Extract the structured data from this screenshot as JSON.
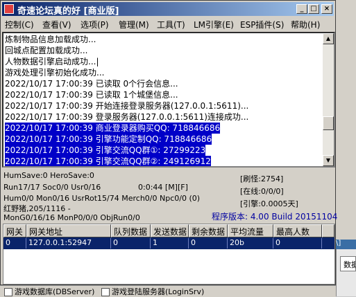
{
  "window": {
    "title": "奇速论坛真的好 [商业版]",
    "min": "_",
    "max": "□",
    "close": "×"
  },
  "menu": [
    "控制(C)",
    "查看(V)",
    "选项(P)",
    "管理(M)",
    "工具(T)",
    "LM引擎(E)",
    "ESP插件(S)",
    "帮助(H)"
  ],
  "log": [
    {
      "text": "炼制物品信息加载成功...",
      "selected": false
    },
    {
      "text": "回城点配置加载成功...",
      "selected": false
    },
    {
      "text": "人物数据引擎启动成功...|",
      "selected": false
    },
    {
      "text": "游戏处理引擎初始化成功...",
      "selected": false
    },
    {
      "text": "2022/10/17 17:00:39 已读取 0个行会信息...",
      "selected": false
    },
    {
      "text": "2022/10/17 17:00:39 已读取 1个城堡信息...",
      "selected": false
    },
    {
      "text": "2022/10/17 17:00:39 开始连接登录服务器(127.0.0.1:5611)...",
      "selected": false
    },
    {
      "text": "2022/10/17 17:00:39 登录服务器(127.0.0.1:5611)连接成功...",
      "selected": false
    },
    {
      "text": "2022/10/17 17:00:39 商业登录器购买QQ: 718846686",
      "selected": true
    },
    {
      "text": "2022/10/17 17:00:39 引擎功能定制QQ: 718846686",
      "selected": true
    },
    {
      "text": "2022/10/17 17:00:39 引擎交流QQ群①: 27299223",
      "selected": true
    },
    {
      "text": "2022/10/17 17:00:39 引擎交流QQ群②: 249126912",
      "selected": true
    }
  ],
  "status": {
    "line1_left": "HumSave:0 HeroSave:0",
    "refresh_monster": "[刷怪:2754]",
    "line2_left": "Run17/17 Soc0/0 Usr0/16",
    "time": "0:0:44 [M][F]",
    "online": "[在线:0/0/0]",
    "line3_left": "Hum0/0 Mon0/16 UsrRot15/74 Merch0/0 Npc0/0 (0)",
    "engine": "[引擎:0.0005天]",
    "line4_left": "红野猪,205/1116 -",
    "version": "程序版本: 4.00 Build 20151104",
    "line5_left": "MonG0/16/16 MonP0/0/0 ObjRun0/0"
  },
  "grid": {
    "columns": [
      "网关",
      "网关地址",
      "队列数据",
      "发送数据",
      "剩余数据",
      "平均流量",
      "最高人数"
    ],
    "rows": [
      [
        "0",
        "127.0.0.1:52947",
        "0",
        "1",
        "0",
        "20b",
        "0"
      ]
    ]
  },
  "background": {
    "right_title": "\\]",
    "right_button": "数据",
    "bottom_text1": "游戏数据库(DBServer)",
    "bottom_text2": "游戏登陆服务器(LoginSrv)"
  }
}
